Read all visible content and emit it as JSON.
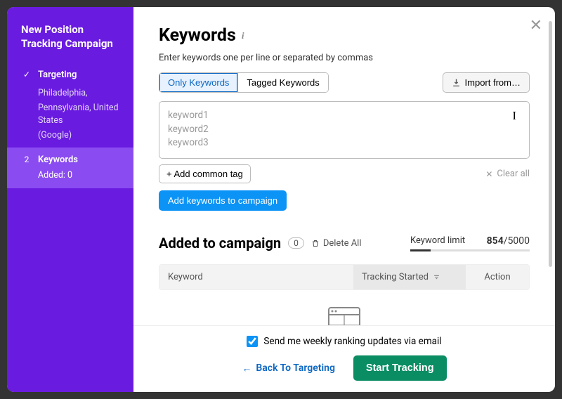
{
  "sidebar": {
    "title": "New Position Tracking Campaign",
    "step1": {
      "label": "Targeting",
      "loc1": "Philadelphia,",
      "loc2": "Pennsylvania, United States",
      "engine": "(Google)"
    },
    "step2": {
      "num": "2",
      "label": "Keywords",
      "added": "Added: 0"
    }
  },
  "header": {
    "title": "Keywords",
    "sub": "Enter keywords one per line or separated by commas"
  },
  "tabs": {
    "only": "Only Keywords",
    "tagged": "Tagged Keywords"
  },
  "import": "Import from…",
  "textarea": {
    "l1": "keyword1",
    "l2": "keyword2",
    "l3": "keyword3"
  },
  "addtag": "+ Add common tag",
  "clearall": "Clear all",
  "addkw": "Add keywords to campaign",
  "added": {
    "title": "Added to campaign",
    "count": "0",
    "deleteall": "Delete All"
  },
  "limit": {
    "label": "Keyword limit",
    "used": "854",
    "sep": "/",
    "total": "5000"
  },
  "table": {
    "c1": "Keyword",
    "c2": "Tracking Started",
    "c3": "Action"
  },
  "check": "Send me weekly ranking updates via email",
  "back": "Back To Targeting",
  "start": "Start Tracking"
}
